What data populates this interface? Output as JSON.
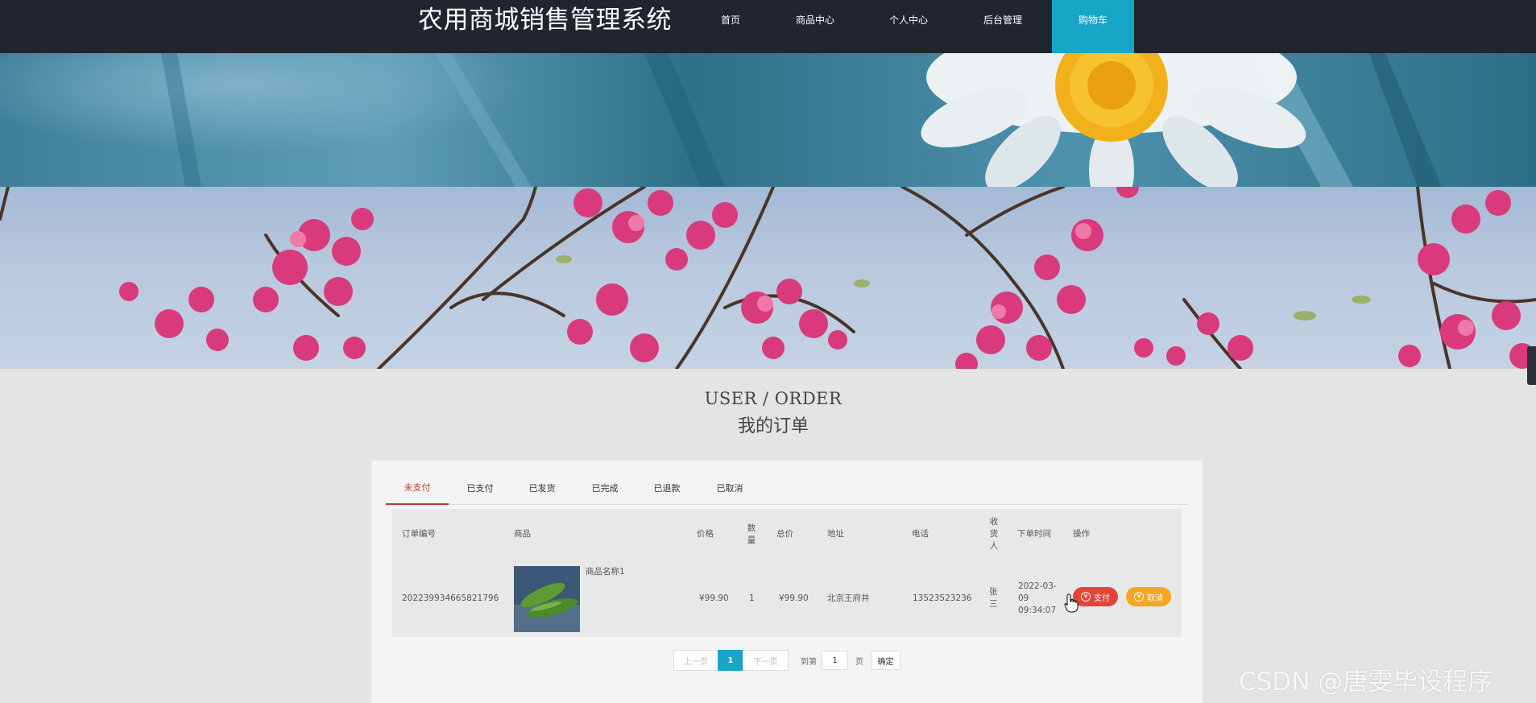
{
  "nav": {
    "site_title": "农用商城销售管理系统",
    "items": [
      {
        "label": "首页"
      },
      {
        "label": "商品中心"
      },
      {
        "label": "个人中心"
      },
      {
        "label": "后台管理"
      },
      {
        "label": "购物车"
      }
    ],
    "active_index": 4,
    "active_color": "#17a5c8",
    "bar_color": "#21252d"
  },
  "heading": {
    "en": "USER / ORDER",
    "cn": "我的订单"
  },
  "tabs": [
    {
      "label": "未支付"
    },
    {
      "label": "已支付"
    },
    {
      "label": "已发货"
    },
    {
      "label": "已完成"
    },
    {
      "label": "已退款"
    },
    {
      "label": "已取消"
    }
  ],
  "active_tab_color": "#c0392b",
  "table": {
    "headers": {
      "order_no": "订单编号",
      "product": "商品",
      "price": "价格",
      "qty": "数量",
      "total": "总价",
      "address": "地址",
      "phone": "电话",
      "receiver": "收货人",
      "order_time": "下单时间",
      "actions": "操作"
    },
    "rows": [
      {
        "order_no": "202239934665821796",
        "product_name": "商品名称1",
        "price": "¥99.90",
        "qty": "1",
        "total": "¥99.90",
        "address": "北京王府井",
        "phone": "13523523236",
        "receiver": "张三",
        "order_time": "2022-03-09 09:34:07",
        "pay_label": "支付",
        "cancel_label": "取消"
      }
    ]
  },
  "pagination": {
    "prev": "上一页",
    "current": "1",
    "next": "下一页",
    "goto_prefix": "到第",
    "goto_value": "1",
    "goto_suffix": "页",
    "confirm": "确定"
  },
  "watermark": "CSDN @唐雯毕设程序",
  "icons": {
    "currency": "coin-icon",
    "cursor": "hand-pointer-icon"
  }
}
